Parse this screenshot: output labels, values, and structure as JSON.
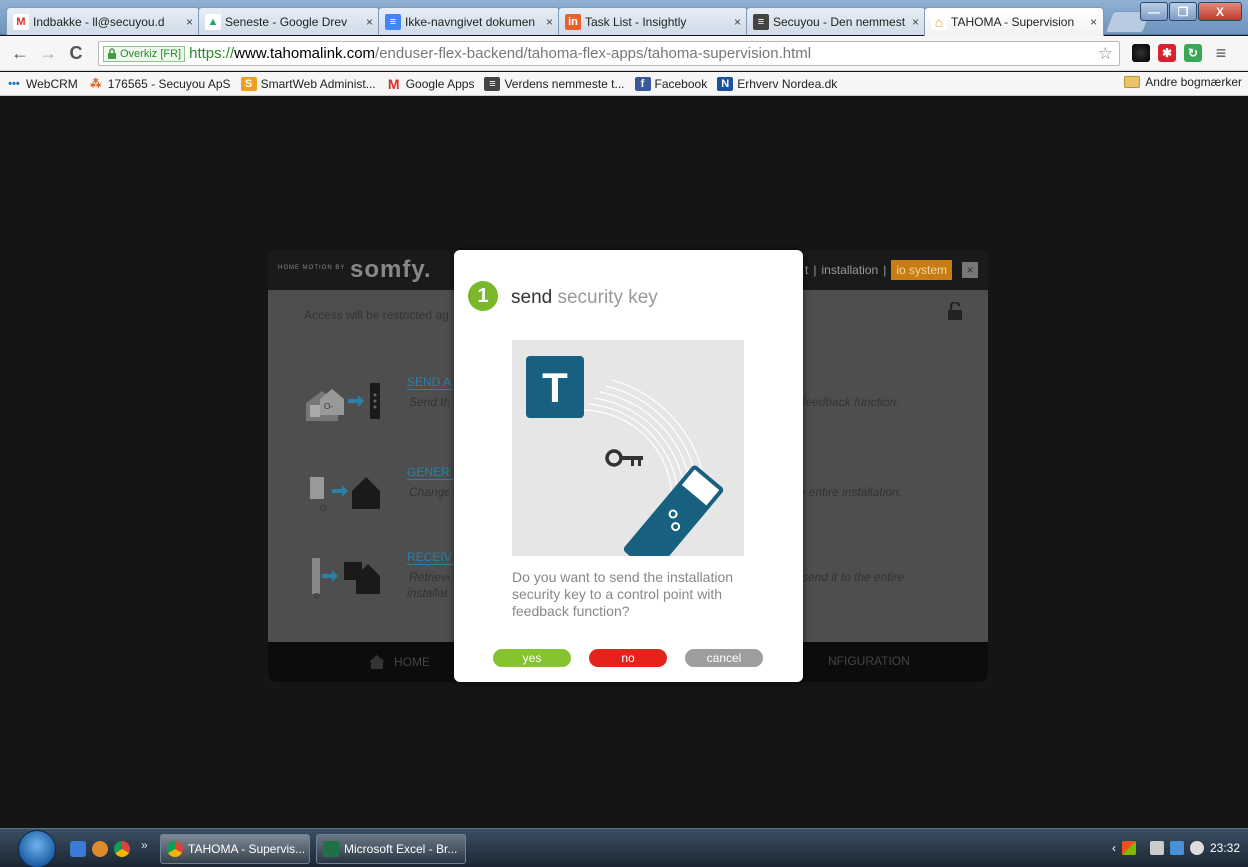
{
  "browser": {
    "tabs": [
      {
        "title": "Indbakke - ll@secuyou.d",
        "icon": "gmail-icon",
        "color": "#d93025",
        "glyph": "M"
      },
      {
        "title": "Seneste - Google Drev",
        "icon": "drive-icon",
        "color": "#1fa463",
        "glyph": "▲"
      },
      {
        "title": "Ikke-navngivet dokumen",
        "icon": "docs-icon",
        "color": "#4285f4",
        "glyph": "≡"
      },
      {
        "title": "Task List - Insightly",
        "icon": "insightly-icon",
        "color": "#e8622c",
        "glyph": "in"
      },
      {
        "title": "Secuyou - Den nemmest",
        "icon": "secuyou-icon",
        "color": "#444444",
        "glyph": "≡"
      },
      {
        "title": "TAHOMA - Supervision",
        "icon": "tahoma-icon",
        "color": "#e6a817",
        "glyph": "⌂"
      }
    ],
    "close_glyph": "×",
    "window_buttons": {
      "minimize": "—",
      "maximize": "❐",
      "close": "X"
    },
    "nav": {
      "back": "←",
      "forward": "→",
      "reload": "C"
    },
    "address": {
      "ev_label": "Overkiz [FR]",
      "scheme": "https://",
      "host": "www.tahomalink.com",
      "path": "/enduser-flex-backend/tahoma-flex-apps/tahoma-supervision.html"
    },
    "star": "☆",
    "menu_glyph": "≡",
    "bookmarks": [
      {
        "label": "WebCRM",
        "icon": "webcrm-icon",
        "color": "#1f6fc2",
        "glyph": "•••"
      },
      {
        "label": "176565 - Secuyou ApS",
        "icon": "crm-bookmark-icon",
        "color": "#e05a12",
        "glyph": "⁂"
      },
      {
        "label": "SmartWeb Administ...",
        "icon": "smartweb-icon",
        "color": "#f0a020",
        "glyph": "S"
      },
      {
        "label": "Google Apps",
        "icon": "gmail-icon",
        "color": "#d93025",
        "glyph": "M"
      },
      {
        "label": "Verdens nemmeste t...",
        "icon": "secuyou-icon",
        "color": "#444444",
        "glyph": "≡"
      },
      {
        "label": "Facebook",
        "icon": "facebook-icon",
        "color": "#3b5998",
        "glyph": "f"
      },
      {
        "label": "Erhverv Nordea.dk",
        "icon": "nordea-icon",
        "color": "#1b4fa0",
        "glyph": "N"
      }
    ],
    "other_bookmarks": "Andre bogmærker"
  },
  "app": {
    "brand_tag": "HOME MOTION BY",
    "brand": "somfy.",
    "nav_partial": "t",
    "nav_installation": "installation",
    "nav_io": "io system",
    "close_glyph": "×",
    "access_text": "Access will be restricted ag",
    "actions": [
      {
        "title": "SEND A",
        "desc": "Send th",
        "right": "h feedback function."
      },
      {
        "title": "GENER",
        "desc": "Change",
        "right": "he entire installation."
      },
      {
        "title": "RECEIV",
        "desc": "Retrieve",
        "desc2": "installati",
        "right": "d send it to the entire"
      }
    ],
    "footer_home": "HOME",
    "footer_config": "NFIGURATION"
  },
  "dialog": {
    "step": "1",
    "title_strong": "send",
    "title_light": "security key",
    "badge_letter": "T",
    "question": "Do you want to send the installation security key to a control point with feedback function?",
    "buttons": {
      "yes": "yes",
      "no": "no",
      "cancel": "cancel"
    },
    "colors": {
      "accent_green": "#78b82a",
      "badge_blue": "#17607f",
      "no_red": "#e4231b"
    }
  },
  "taskbar": {
    "more": "»",
    "windows": [
      {
        "label": "TAHOMA - Supervis...",
        "icon": "chrome-icon"
      },
      {
        "label": "Microsoft Excel - Br...",
        "icon": "excel-icon"
      }
    ],
    "clock": "23:32",
    "tray_arrow": "‹"
  }
}
